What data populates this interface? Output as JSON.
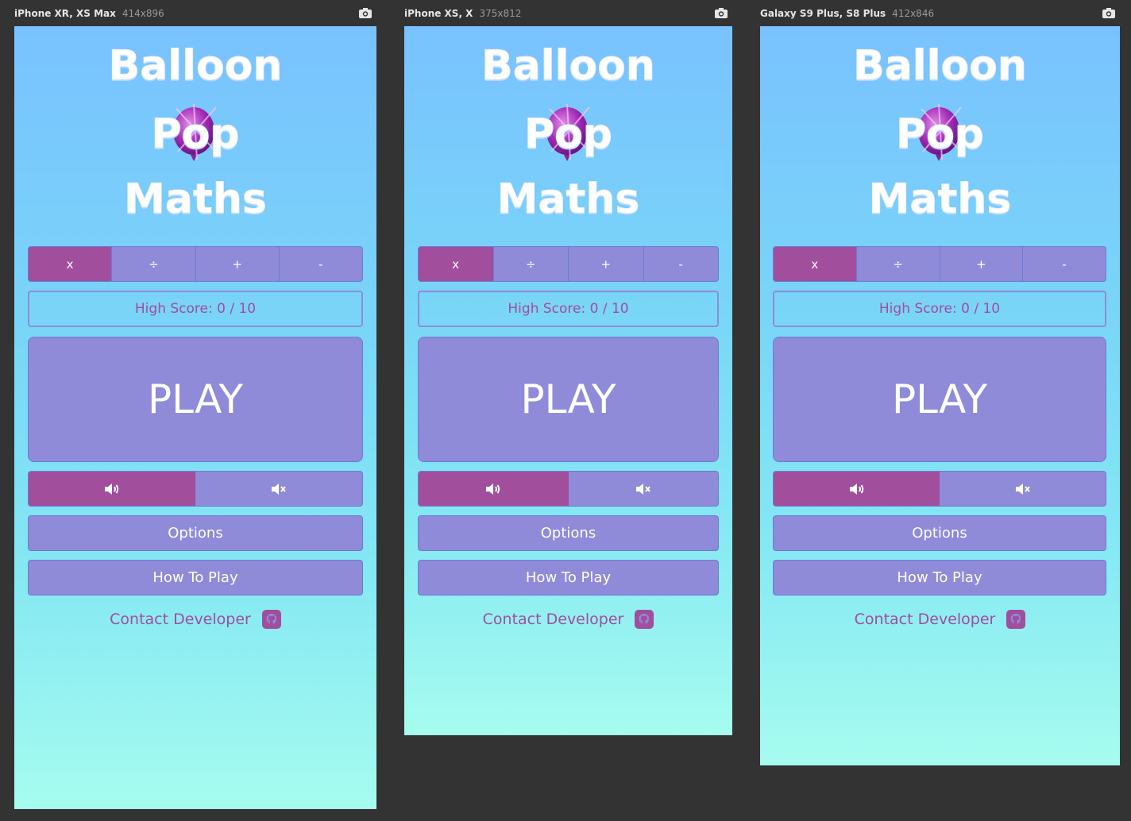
{
  "devices": [
    {
      "name": "iPhone XR, XS Max",
      "dims": "414x896"
    },
    {
      "name": "iPhone XS, X",
      "dims": "375x812"
    },
    {
      "name": "Galaxy S9 Plus, S8 Plus",
      "dims": "412x846"
    }
  ],
  "app": {
    "title_line1": "Balloon",
    "title_line2": "Pop",
    "title_line3": "Maths",
    "operations": [
      "x",
      "÷",
      "+",
      "-"
    ],
    "active_operation": "x",
    "high_score": "High Score: 0 / 10",
    "play_label": "PLAY",
    "sound_on_icon": "speaker-on-icon",
    "sound_off_icon": "speaker-mute-icon",
    "sound_state": "on",
    "options_label": "Options",
    "how_to_play_label": "How To Play",
    "contact_label": "Contact Developer",
    "contact_icon": "github-icon"
  },
  "colors": {
    "accent": "#a14e9d",
    "button": "#8f8bd8",
    "background_top": "#79c2ff",
    "background_bottom": "#a6fcef",
    "editor_background": "#333333"
  }
}
